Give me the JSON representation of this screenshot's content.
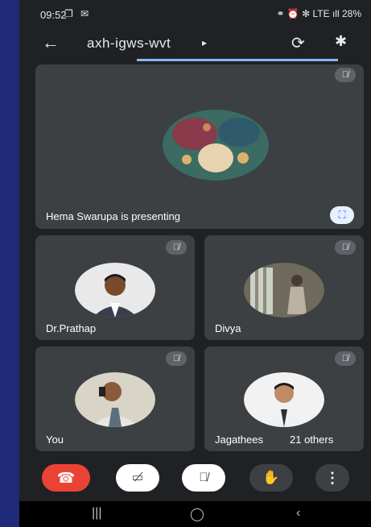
{
  "status_bar": {
    "time": "09:52",
    "status_icons": "❐ ✉",
    "right_text": "⚭ ⏰ ✻ LTE ıll 28%"
  },
  "app_bar": {
    "meeting_code": "axh-igws-wvt",
    "caret": "▸"
  },
  "presenting_tile": {
    "label": "Hema Swarupa is presenting"
  },
  "participants": [
    {
      "name": "Dr.Prathap"
    },
    {
      "name": "Divya"
    },
    {
      "name": "You"
    },
    {
      "name": "Jagathees"
    }
  ],
  "others_label": "21 others",
  "icons": {
    "mic_off": "🎙̸",
    "fullscreen": "⛶",
    "end_call": "☎",
    "camera_off": "▭̸",
    "raise_hand": "✋",
    "more": "⋮",
    "back": "←",
    "camera_switch": "⟳",
    "bluetooth": "✱",
    "nav_recent": "|||",
    "nav_home": "◯",
    "nav_back": "‹"
  },
  "colors": {
    "background": "#1f2a78",
    "app": "#202124",
    "tile": "#3c4043",
    "end_call": "#ea4335",
    "accent": "#8ab4f8"
  }
}
